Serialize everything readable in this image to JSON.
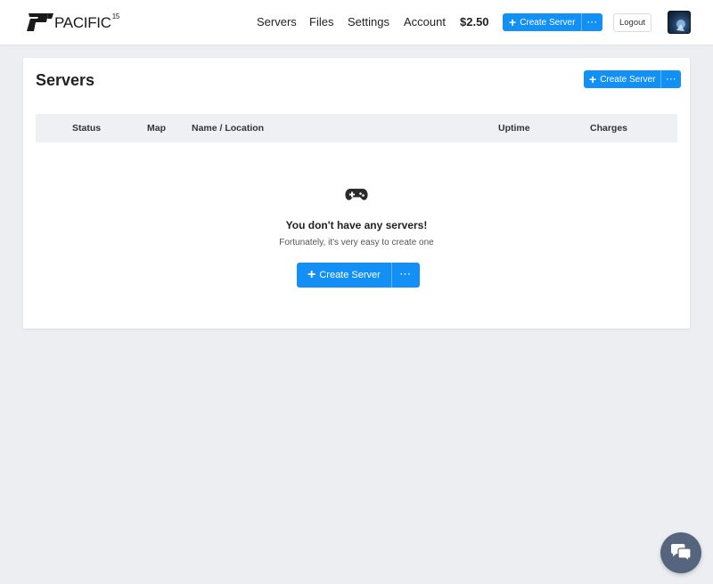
{
  "header": {
    "logo_text": "PACIFIC",
    "logo_sup": "15",
    "nav": {
      "servers": "Servers",
      "files": "Files",
      "settings": "Settings",
      "account": "Account"
    },
    "balance": "$2.50",
    "create_server_label": "Create Server",
    "more_label": "···",
    "logout_label": "Logout"
  },
  "servers_panel": {
    "title": "Servers",
    "create_server_label": "Create Server",
    "more_label": "···",
    "columns": [
      "Status",
      "Map",
      "Name / Location",
      "Uptime",
      "Charges"
    ],
    "empty_state": {
      "icon": "gamepad-icon",
      "title": "You don't have any servers!",
      "subtitle": "Fortunately, it's very easy to create one",
      "create_server_label": "Create Server",
      "more_label": "···"
    }
  },
  "chat_widget": {
    "icon": "chat-bubbles-icon"
  },
  "colors": {
    "accent": "#1290f5",
    "page_bg": "#eceef2",
    "table_header_bg": "#eef0f3",
    "chat_bg": "#56657e"
  }
}
